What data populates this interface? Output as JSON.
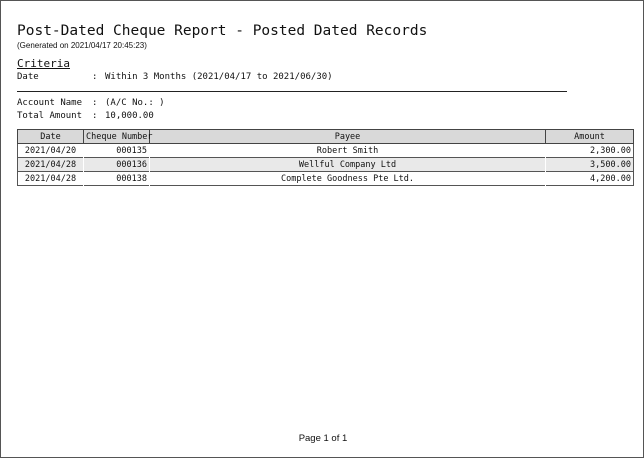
{
  "report": {
    "title": "Post-Dated Cheque Report - Posted Dated Records",
    "generated": "(Generated on 2021/04/17 20:45:23)"
  },
  "criteria": {
    "heading": "Criteria",
    "date_label": "Date",
    "date_colon": ":",
    "date_value": "Within 3 Months (2021/04/17 to 2021/06/30)"
  },
  "summary": {
    "account_label": "Account Name",
    "account_colon": ":",
    "account_value": "(A/C No.: )",
    "total_label": "Total Amount",
    "total_colon": ":",
    "total_value": "10,000.00"
  },
  "table": {
    "headers": [
      "Date",
      "Cheque Number",
      "Payee",
      "Amount"
    ],
    "rows": [
      [
        "2021/04/20",
        "000135",
        "Robert Smith",
        "2,300.00"
      ],
      [
        "2021/04/28",
        "000136",
        "Wellful Company Ltd",
        "3,500.00"
      ],
      [
        "2021/04/28",
        "000138",
        "Complete Goodness Pte Ltd.",
        "4,200.00"
      ]
    ]
  },
  "footer": {
    "page_label": "Page 1 of 1"
  }
}
